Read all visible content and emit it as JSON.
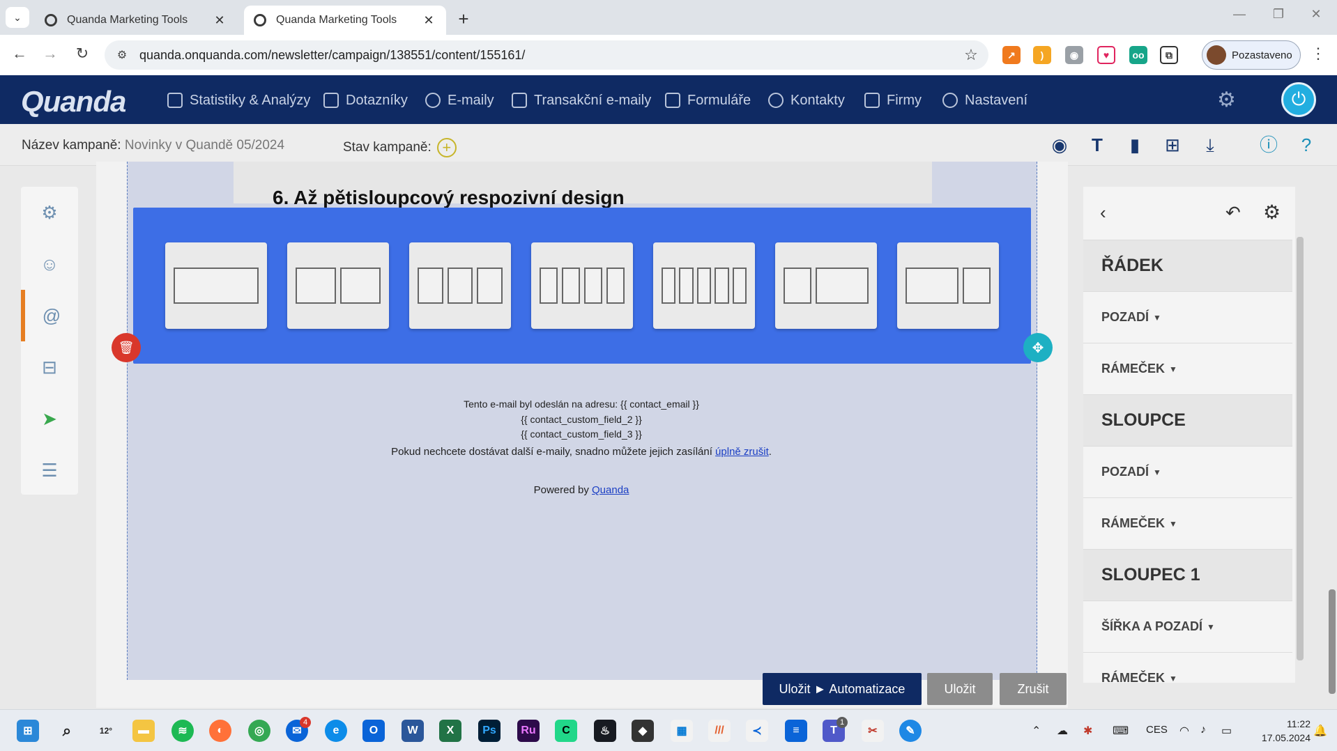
{
  "browser": {
    "tabs": [
      {
        "title": "Quanda Marketing Tools",
        "active": false
      },
      {
        "title": "Quanda Marketing Tools",
        "active": true
      }
    ],
    "url": "quanda.onquanda.com/newsletter/campaign/138551/content/155161/",
    "profile_label": "Pozastaveno"
  },
  "app": {
    "logo": "Quanda",
    "menu": [
      {
        "label": "Statistiky & Analýzy",
        "icon": "chart-icon"
      },
      {
        "label": "Dotazníky",
        "icon": "survey-icon"
      },
      {
        "label": "E-maily",
        "icon": "at-icon"
      },
      {
        "label": "Transakční e-maily",
        "icon": "transaction-icon"
      },
      {
        "label": "Formuláře",
        "icon": "form-icon"
      },
      {
        "label": "Kontakty",
        "icon": "contacts-icon"
      },
      {
        "label": "Firmy",
        "icon": "company-icon"
      },
      {
        "label": "Nastavení",
        "icon": "gear-icon"
      }
    ]
  },
  "campaign": {
    "name_label": "Název kampaně:",
    "name_value": "Novinky v Quandě 05/2024",
    "state_label": "Stav kampaně:"
  },
  "editor": {
    "heading": "6. Až pětisloupcový respozivní design",
    "footer_lines": [
      "Tento e-mail byl odeslán na adresu: {{ contact_email }}",
      "{{ contact_custom_field_2 }}",
      "{{ contact_custom_field_3 }}"
    ],
    "unsubscribe_prefix": "Pokud nechcete dostávat další e-maily, snadno můžete jejich zasílání ",
    "unsubscribe_link": "úplně zrušit",
    "unsubscribe_suffix": ".",
    "powered_prefix": "Powered by ",
    "powered_link": "Quanda",
    "layouts": [
      {
        "name": "1 column",
        "cols": [
          1
        ]
      },
      {
        "name": "2 columns",
        "cols": [
          1,
          1
        ]
      },
      {
        "name": "3 columns",
        "cols": [
          1,
          1,
          1
        ]
      },
      {
        "name": "4 columns",
        "cols": [
          1,
          1,
          1,
          1
        ]
      },
      {
        "name": "5 columns",
        "cols": [
          1,
          1,
          1,
          1,
          1
        ]
      },
      {
        "name": "1:2 columns",
        "cols": [
          1,
          2
        ]
      },
      {
        "name": "2:1 columns",
        "cols": [
          2,
          1
        ]
      }
    ]
  },
  "right_panel": {
    "rows": [
      {
        "label": "ŘÁDEK",
        "kind": "sect"
      },
      {
        "label": "POZADÍ",
        "kind": "sub"
      },
      {
        "label": "RÁMEČEK",
        "kind": "sub"
      },
      {
        "label": "SLOUPCE",
        "kind": "sect"
      },
      {
        "label": "POZADÍ",
        "kind": "sub"
      },
      {
        "label": "RÁMEČEK",
        "kind": "sub"
      },
      {
        "label": "SLOUPEC 1",
        "kind": "sect"
      },
      {
        "label": "ŠÍŘKA A POZADÍ",
        "kind": "sub"
      },
      {
        "label": "RÁMEČEK",
        "kind": "sub"
      }
    ]
  },
  "buttons": {
    "save_automation": "Uložit ► Automatizace",
    "save": "Uložit",
    "cancel": "Zrušit"
  },
  "taskbar": {
    "weather": "12°",
    "mail_badge": "4",
    "teams_badge": "1",
    "language": "CES",
    "time": "11:22",
    "date": "17.05.2024"
  },
  "colors": {
    "nav_bg": "#0f2a63",
    "layout_picker_bg": "#3d6ee6",
    "accent_orange": "#e67e22",
    "delete_red": "#d9372b",
    "move_teal": "#1db0c3"
  }
}
